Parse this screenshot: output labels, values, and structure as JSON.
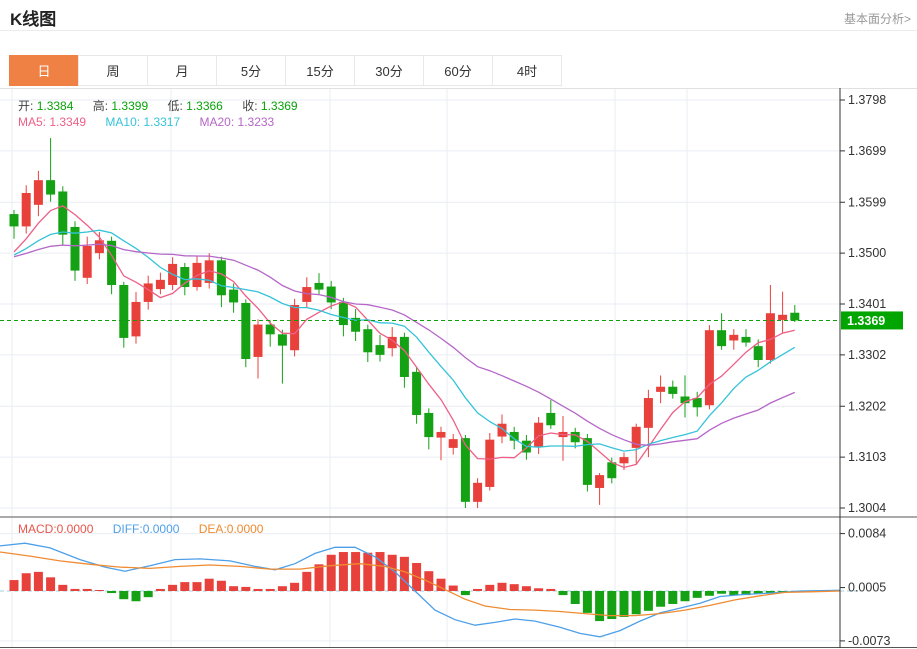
{
  "header": {
    "title": "K线图",
    "link": "基本面分析>"
  },
  "tabs": {
    "items": [
      "日",
      "周",
      "月",
      "5分",
      "15分",
      "30分",
      "60分",
      "4时"
    ],
    "active_index": 0
  },
  "legend": {
    "ohlc": [
      {
        "label": "开:",
        "value": "1.3384"
      },
      {
        "label": "高:",
        "value": "1.3399"
      },
      {
        "label": "低:",
        "value": "1.3366"
      },
      {
        "label": "收:",
        "value": "1.3369"
      }
    ],
    "ma": [
      {
        "label": "MA5:",
        "value": "1.3349",
        "color": "#ee5f86"
      },
      {
        "label": "MA10:",
        "value": "1.3317",
        "color": "#35c3da"
      },
      {
        "label": "MA20:",
        "value": "1.3233",
        "color": "#b666c8"
      }
    ],
    "macd": [
      {
        "label": "MACD:",
        "value": "0.0000",
        "color": "#e8544a"
      },
      {
        "label": "DIFF:",
        "value": "0.0000",
        "color": "#4d9fe8"
      },
      {
        "label": "DEA:",
        "value": "0.0000",
        "color": "#ef8b31"
      }
    ]
  },
  "colors": {
    "up": "#e8403a",
    "down": "#14a114",
    "accent_tab": "#ef8144",
    "price_tag_bg": "#00a500",
    "current_price_line": "#0ca00c",
    "grid": "#e9eef4",
    "axis_line": "#333333",
    "axis_text": "#333333",
    "zero_line": "#9fd0e0",
    "divider": "#555555"
  },
  "chart_data": {
    "type": "candlestick+macd",
    "timeframe_selected": "日",
    "price_axis": {
      "max": 1.3798,
      "min": 1.3004,
      "ticks": [
        "1.3798",
        "1.3699",
        "1.3599",
        "1.3500",
        "1.3401",
        "1.3302",
        "1.3202",
        "1.3103",
        "1.3004"
      ],
      "tick_values": [
        1.3798,
        1.3699,
        1.3599,
        1.35,
        1.3401,
        1.3302,
        1.3202,
        1.3103,
        1.3004
      ]
    },
    "current_price": {
      "label": "1.3369",
      "value": 1.3369
    },
    "macd_axis": {
      "ticks": [
        "0.0084",
        "0.0005",
        "-0.0073"
      ],
      "tick_values": [
        0.0084,
        0.0005,
        -0.0073
      ]
    },
    "ma_periods": [
      5,
      10,
      20
    ],
    "ma_prehistory_value": 1.349,
    "candles_ohlc": [
      [
        1.3576,
        1.3584,
        1.3528,
        1.3552
      ],
      [
        1.3552,
        1.3632,
        1.3538,
        1.3617
      ],
      [
        1.3594,
        1.366,
        1.3572,
        1.3642
      ],
      [
        1.3642,
        1.3724,
        1.36,
        1.3614
      ],
      [
        1.362,
        1.363,
        1.3516,
        1.3536
      ],
      [
        1.3551,
        1.3562,
        1.3446,
        1.3466
      ],
      [
        1.3452,
        1.3532,
        1.344,
        1.3514
      ],
      [
        1.35,
        1.3541,
        1.3488,
        1.3525
      ],
      [
        1.3524,
        1.3532,
        1.342,
        1.3438
      ],
      [
        1.3438,
        1.3444,
        1.3316,
        1.3335
      ],
      [
        1.3338,
        1.3424,
        1.3324,
        1.3405
      ],
      [
        1.3405,
        1.3456,
        1.339,
        1.3441
      ],
      [
        1.343,
        1.3462,
        1.342,
        1.3448
      ],
      [
        1.3438,
        1.3492,
        1.3428,
        1.3479
      ],
      [
        1.3473,
        1.3481,
        1.3418,
        1.3434
      ],
      [
        1.3434,
        1.3495,
        1.3427,
        1.3481
      ],
      [
        1.3442,
        1.35,
        1.3431,
        1.3486
      ],
      [
        1.3486,
        1.3493,
        1.3395,
        1.3418
      ],
      [
        1.3429,
        1.3441,
        1.3384,
        1.3404
      ],
      [
        1.3403,
        1.341,
        1.3278,
        1.3294
      ],
      [
        1.3298,
        1.3371,
        1.3256,
        1.3361
      ],
      [
        1.3361,
        1.3369,
        1.3318,
        1.3342
      ],
      [
        1.3342,
        1.3351,
        1.3246,
        1.332
      ],
      [
        1.3311,
        1.3411,
        1.3299,
        1.3399
      ],
      [
        1.3405,
        1.3453,
        1.3395,
        1.3434
      ],
      [
        1.3442,
        1.3461,
        1.3419,
        1.3429
      ],
      [
        1.3435,
        1.3446,
        1.3391,
        1.3404
      ],
      [
        1.3405,
        1.3413,
        1.3338,
        1.336
      ],
      [
        1.3374,
        1.3391,
        1.3329,
        1.3347
      ],
      [
        1.3352,
        1.3361,
        1.3288,
        1.3307
      ],
      [
        1.3321,
        1.3341,
        1.3289,
        1.3302
      ],
      [
        1.3315,
        1.3356,
        1.3299,
        1.3337
      ],
      [
        1.3337,
        1.3345,
        1.3238,
        1.3259
      ],
      [
        1.3269,
        1.3278,
        1.3168,
        1.3185
      ],
      [
        1.3189,
        1.3198,
        1.3118,
        1.3142
      ],
      [
        1.3141,
        1.3162,
        1.3097,
        1.3152
      ],
      [
        1.3121,
        1.3148,
        1.3108,
        1.3138
      ],
      [
        1.314,
        1.3146,
        1.3004,
        1.3016
      ],
      [
        1.3016,
        1.3062,
        1.3004,
        1.3053
      ],
      [
        1.3045,
        1.315,
        1.3038,
        1.3137
      ],
      [
        1.3143,
        1.3186,
        1.313,
        1.3168
      ],
      [
        1.3152,
        1.3162,
        1.3118,
        1.3135
      ],
      [
        1.3135,
        1.3146,
        1.3098,
        1.3112
      ],
      [
        1.3122,
        1.3181,
        1.3109,
        1.317
      ],
      [
        1.3189,
        1.3214,
        1.3158,
        1.3165
      ],
      [
        1.3142,
        1.3183,
        1.3096,
        1.3152
      ],
      [
        1.3152,
        1.316,
        1.312,
        1.3132
      ],
      [
        1.314,
        1.3148,
        1.3036,
        1.3049
      ],
      [
        1.3043,
        1.3072,
        1.301,
        1.3068
      ],
      [
        1.3093,
        1.3102,
        1.3052,
        1.3062
      ],
      [
        1.3091,
        1.3112,
        1.3078,
        1.3103
      ],
      [
        1.3121,
        1.3168,
        1.3091,
        1.3162
      ],
      [
        1.316,
        1.3234,
        1.3103,
        1.3218
      ],
      [
        1.323,
        1.3262,
        1.3208,
        1.324
      ],
      [
        1.324,
        1.3252,
        1.3217,
        1.3226
      ],
      [
        1.3221,
        1.3262,
        1.318,
        1.3208
      ],
      [
        1.3218,
        1.323,
        1.3182,
        1.32
      ],
      [
        1.3204,
        1.336,
        1.3196,
        1.335
      ],
      [
        1.335,
        1.3383,
        1.3312,
        1.3319
      ],
      [
        1.333,
        1.3352,
        1.3312,
        1.3341
      ],
      [
        1.3337,
        1.3352,
        1.3318,
        1.3326
      ],
      [
        1.3319,
        1.3332,
        1.3278,
        1.3292
      ],
      [
        1.3292,
        1.3438,
        1.3285,
        1.3383
      ],
      [
        1.337,
        1.3425,
        1.3345,
        1.338
      ],
      [
        1.3384,
        1.3399,
        1.3366,
        1.3369
      ]
    ],
    "macd_hist": [
      0.0016,
      0.0026,
      0.0028,
      0.002,
      0.0009,
      0.0003,
      0.0003,
      0.0001,
      -0.0003,
      -0.0012,
      -0.0015,
      -0.0009,
      0.0003,
      0.0009,
      0.0013,
      0.0013,
      0.0018,
      0.0015,
      0.0007,
      0.0006,
      0.0003,
      0.0003,
      0.0007,
      0.0012,
      0.0028,
      0.0039,
      0.0053,
      0.0057,
      0.0057,
      0.0056,
      0.0057,
      0.0053,
      0.005,
      0.0041,
      0.0029,
      0.0018,
      0.0008,
      -0.0006,
      0.0003,
      0.0009,
      0.0012,
      0.001,
      0.0007,
      0.0004,
      0.0003,
      -0.0006,
      -0.0019,
      -0.0032,
      -0.0044,
      -0.0041,
      -0.0038,
      -0.0034,
      -0.0029,
      -0.0023,
      -0.0019,
      -0.0015,
      -0.001,
      -0.0007,
      -0.0004,
      -0.0006,
      -0.0006,
      -0.0004,
      -0.0003,
      -0.0002,
      -0.0001
    ],
    "diff_line": [
      [
        0,
        0.0066
      ],
      [
        25,
        0.007
      ],
      [
        50,
        0.0063
      ],
      [
        80,
        0.0046
      ],
      [
        105,
        0.0035
      ],
      [
        125,
        0.0029
      ],
      [
        150,
        0.0037
      ],
      [
        175,
        0.0046
      ],
      [
        200,
        0.0047
      ],
      [
        230,
        0.0044
      ],
      [
        255,
        0.0036
      ],
      [
        275,
        0.0031
      ],
      [
        295,
        0.004
      ],
      [
        315,
        0.0055
      ],
      [
        335,
        0.0064
      ],
      [
        355,
        0.0064
      ],
      [
        375,
        0.005
      ],
      [
        395,
        0.0028
      ],
      [
        415,
        0.0
      ],
      [
        435,
        -0.0028
      ],
      [
        455,
        -0.0042
      ],
      [
        475,
        -0.005
      ],
      [
        495,
        -0.0046
      ],
      [
        515,
        -0.0041
      ],
      [
        535,
        -0.0044
      ],
      [
        560,
        -0.0053
      ],
      [
        580,
        -0.0062
      ],
      [
        600,
        -0.0067
      ],
      [
        620,
        -0.0058
      ],
      [
        640,
        -0.0044
      ],
      [
        660,
        -0.0032
      ],
      [
        680,
        -0.0025
      ],
      [
        700,
        -0.0018
      ],
      [
        720,
        -0.0008
      ],
      [
        745,
        -0.0005
      ],
      [
        770,
        -0.0003
      ],
      [
        800,
        0.0
      ],
      [
        840,
        0.0001
      ]
    ],
    "dea_line": [
      [
        0,
        0.0057
      ],
      [
        30,
        0.0051
      ],
      [
        60,
        0.0044
      ],
      [
        90,
        0.0039
      ],
      [
        120,
        0.0035
      ],
      [
        150,
        0.0033
      ],
      [
        180,
        0.0036
      ],
      [
        210,
        0.0038
      ],
      [
        240,
        0.0036
      ],
      [
        270,
        0.0032
      ],
      [
        300,
        0.0032
      ],
      [
        330,
        0.0037
      ],
      [
        360,
        0.004
      ],
      [
        385,
        0.0036
      ],
      [
        405,
        0.0028
      ],
      [
        425,
        0.0016
      ],
      [
        445,
        0.0002
      ],
      [
        465,
        -0.0012
      ],
      [
        485,
        -0.0022
      ],
      [
        510,
        -0.0027
      ],
      [
        535,
        -0.0028
      ],
      [
        560,
        -0.003
      ],
      [
        585,
        -0.0033
      ],
      [
        610,
        -0.0036
      ],
      [
        635,
        -0.0036
      ],
      [
        660,
        -0.0033
      ],
      [
        685,
        -0.0028
      ],
      [
        710,
        -0.0021
      ],
      [
        735,
        -0.0013
      ],
      [
        760,
        -0.0007
      ],
      [
        785,
        -0.0002
      ],
      [
        815,
        -0.0001
      ],
      [
        840,
        0.0
      ]
    ]
  }
}
